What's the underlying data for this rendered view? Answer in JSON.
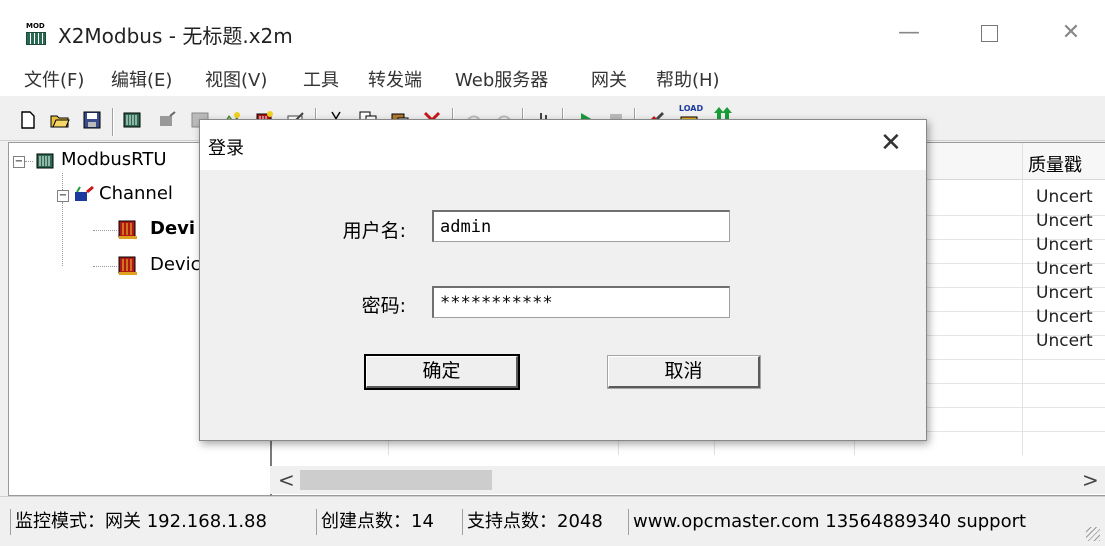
{
  "window": {
    "app_icon_text": "MOD",
    "title": "X2Modbus - 无标题.x2m",
    "minimize_glyph": "—",
    "close_glyph": "✕"
  },
  "menu": {
    "items": [
      "文件(F)",
      "编辑(E)",
      "视图(V)",
      "工具",
      "转发端",
      "Web服务器",
      "网关",
      "帮助(H)"
    ]
  },
  "toolbar": {
    "icons": [
      "new-file-icon",
      "open-folder-icon",
      "save-icon",
      "device-icon",
      "channel-icon",
      "properties-icon",
      "new-channel-icon",
      "new-device-icon",
      "edit-icon",
      "cut-icon",
      "copy-icon",
      "paste-icon",
      "delete-icon",
      "undo-icon",
      "redo-icon",
      "monitor-icon",
      "start-icon",
      "stop-icon",
      "settings-icon",
      "load-icon",
      "update-icon"
    ],
    "load_text": "LOAD"
  },
  "tree": {
    "root": "ModbusRTU",
    "channel": "Channel",
    "device_bold": "Devi",
    "device": "Devic",
    "collapse_glyph": "−"
  },
  "list": {
    "header_last": "质量戳",
    "rows": [
      "Uncert",
      "Uncert",
      "Uncert",
      "Uncert",
      "Uncert",
      "Uncert",
      "Uncert"
    ],
    "scroll_left": "<",
    "scroll_right": ">"
  },
  "status": {
    "mode": "监控模式：网关 192.168.1.88",
    "created": "创建点数：14",
    "supported": "支持点数：2048",
    "contact": "www.opcmaster.com 13564889340 support"
  },
  "login_dialog": {
    "title": "登录",
    "close_glyph": "✕",
    "username_label": "用户名:",
    "username_value": "admin",
    "password_label": "密码:",
    "password_value": "***********",
    "ok_label": "确定",
    "cancel_label": "取消"
  },
  "colors": {
    "accent_green": "#1a9c3a",
    "folder_yellow": "#e8b400",
    "device_red": "#b01818"
  }
}
